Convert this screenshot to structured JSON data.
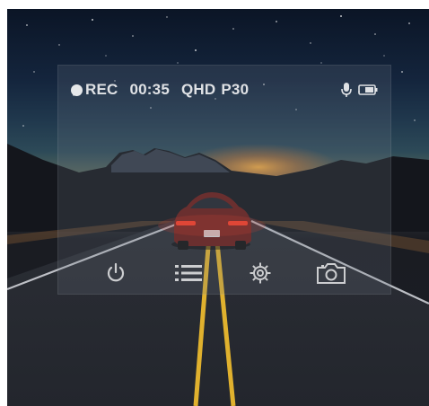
{
  "status": {
    "rec_label": "REC",
    "elapsed_time": "00:35",
    "resolution": "QHD",
    "frame_rate": "P30",
    "mic_icon": "microphone-icon",
    "battery_icon": "battery-icon"
  },
  "toolbar": {
    "items": [
      {
        "icon": "power-icon"
      },
      {
        "icon": "menu-list-icon"
      },
      {
        "icon": "settings-icon"
      },
      {
        "icon": "camera-icon"
      }
    ]
  },
  "colors": {
    "overlay_tint": "#6e7882",
    "icon_color": "#ffffff",
    "road_line": "#e0b12e",
    "horizon_glow": "#f08a2a"
  }
}
